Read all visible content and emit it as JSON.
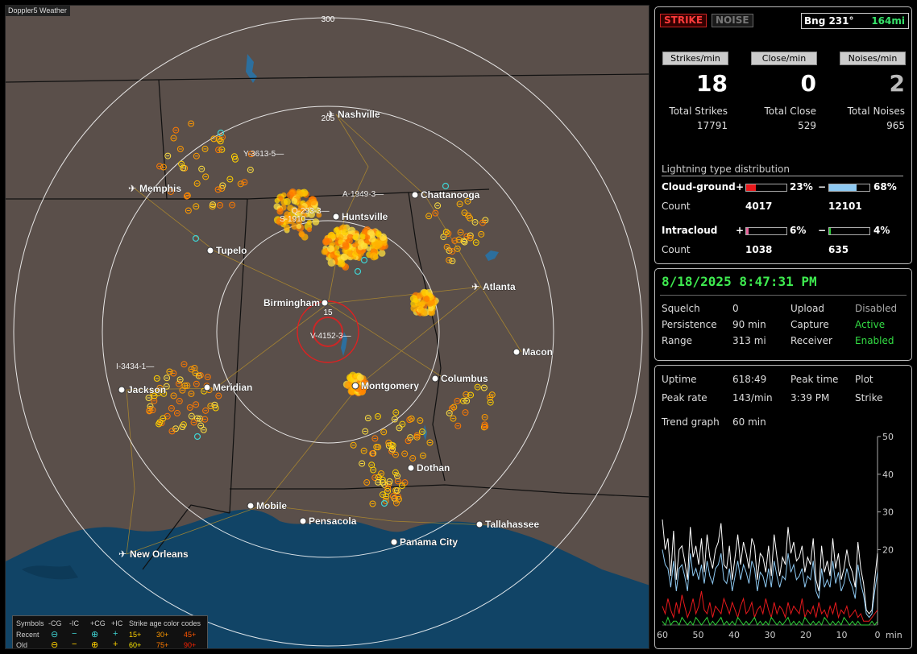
{
  "app": {
    "title": "Doppler5 Weather"
  },
  "map": {
    "rings": [
      {
        "label": "15"
      },
      {
        "label": "205"
      },
      {
        "label": "300"
      }
    ],
    "cities": [
      {
        "name": "Nashville",
        "kind": "airport"
      },
      {
        "name": "Memphis",
        "kind": "airport"
      },
      {
        "name": "Chattanooga",
        "kind": "city"
      },
      {
        "name": "Huntsville",
        "kind": "city"
      },
      {
        "name": "Tupelo",
        "kind": "city"
      },
      {
        "name": "Atlanta",
        "kind": "airport"
      },
      {
        "name": "Birmingham",
        "kind": "city"
      },
      {
        "name": "Macon",
        "kind": "city"
      },
      {
        "name": "Jackson",
        "kind": "city"
      },
      {
        "name": "Meridian",
        "kind": "city"
      },
      {
        "name": "Montgomery",
        "kind": "city"
      },
      {
        "name": "Columbus",
        "kind": "city"
      },
      {
        "name": "Dothan",
        "kind": "city"
      },
      {
        "name": "Mobile",
        "kind": "city"
      },
      {
        "name": "Pensacola",
        "kind": "city"
      },
      {
        "name": "Tallahassee",
        "kind": "city"
      },
      {
        "name": "Panama City",
        "kind": "city"
      },
      {
        "name": "New Orleans",
        "kind": "airport"
      }
    ],
    "cell_labels": [
      "Y-3613-5",
      "A-1949-3",
      "Q-293-3",
      "S-1910",
      "V-4152-3",
      "I-3434-1"
    ],
    "legend": {
      "symbols_label": "Symbols",
      "cols": [
        "-CG",
        "-IC",
        "+CG",
        "+IC"
      ],
      "recent_label": "Recent",
      "old_label": "Old",
      "age_label": "Strike age color codes",
      "recent_ages": [
        "15+",
        "30+",
        "45+"
      ],
      "old_ages": [
        "60+",
        "75+",
        "90+"
      ],
      "age_colors": [
        "#ffd000",
        "#ff9900",
        "#ff5500",
        "#ffea00",
        "#ff7a00",
        "#ff2200"
      ]
    }
  },
  "strike_panel": {
    "strike_tab": "STRIKE",
    "noise_tab": "NOISE",
    "bearing": "Bng 231°",
    "distance": "164mi",
    "strikes_per_min_label": "Strikes/min",
    "close_per_min_label": "Close/min",
    "noises_per_min_label": "Noises/min",
    "strikes_per_min": "18",
    "close_per_min": "0",
    "noises_per_min": "2",
    "total_strikes_label": "Total Strikes",
    "total_close_label": "Total Close",
    "total_noises_label": "Total Noises",
    "total_strikes": "17791",
    "total_close": "529",
    "total_noises": "965",
    "distribution_title": "Lightning type distribution",
    "cloud_ground_label": "Cloud-ground",
    "intracloud_label": "Intracloud",
    "count_label": "Count",
    "plus": "+",
    "minus": "−",
    "cg_pos_pct_text": "23%",
    "cg_neg_pct_text": "68%",
    "cg_pos_count": "4017",
    "cg_neg_count": "12101",
    "ic_pos_pct_text": "6%",
    "ic_neg_pct_text": "4%",
    "ic_pos_count": "1038",
    "ic_neg_count": "635",
    "bar_levels": {
      "cg_pos": 0.23,
      "cg_neg": 0.68,
      "ic_pos": 0.06,
      "ic_neg": 0.04
    },
    "colors": {
      "cg_pos": "#e8191c",
      "cg_neg": "#8ec9f2",
      "ic_pos": "#e8639b",
      "ic_neg": "#2fcf3a"
    }
  },
  "status_panel": {
    "timestamp": "8/18/2025 8:47:31 PM",
    "squelch_label": "Squelch",
    "squelch": "0",
    "persistence_label": "Persistence",
    "persistence": "90 min",
    "range_label": "Range",
    "range": "313 mi",
    "upload_label": "Upload",
    "upload": "Disabled",
    "capture_label": "Capture",
    "capture": "Active",
    "receiver_label": "Receiver",
    "receiver": "Enabled"
  },
  "trend_panel": {
    "uptime_label": "Uptime",
    "uptime": "618:49",
    "peak_time_label": "Peak time",
    "peak_time": "3:39 PM",
    "plot_label": "Plot",
    "plot": "Strike",
    "peak_rate_label": "Peak rate",
    "peak_rate": "143/min",
    "trend_label": "Trend graph",
    "trend": "60 min"
  },
  "chart_data": {
    "type": "line",
    "xlabel": "min",
    "x_ticks": [
      "60",
      "50",
      "40",
      "30",
      "20",
      "10",
      "0"
    ],
    "y_ticks": [
      "20",
      "30",
      "40",
      "50"
    ],
    "xlim": [
      60,
      0
    ],
    "ylim": [
      0,
      50
    ],
    "series": [
      {
        "color": "#ffffff",
        "values": [
          28,
          20,
          23,
          13,
          25,
          12,
          20,
          21,
          17,
          12,
          26,
          18,
          21,
          16,
          23,
          14,
          24,
          18,
          15,
          20,
          22,
          27,
          16,
          15,
          21,
          12,
          18,
          24,
          16,
          22,
          19,
          15,
          23,
          21,
          12,
          19,
          18,
          14,
          21,
          13,
          24,
          18,
          13,
          18,
          16,
          26,
          19,
          22,
          17,
          18,
          21,
          14,
          18,
          16,
          23,
          12,
          9,
          21,
          14,
          17,
          13,
          23,
          15,
          19,
          12,
          15,
          20,
          16,
          14,
          10,
          22,
          15,
          11,
          4,
          3,
          4,
          12,
          19
        ]
      },
      {
        "color": "#8ec9f2",
        "values": [
          20,
          16,
          15,
          10,
          17,
          9,
          15,
          16,
          13,
          9,
          19,
          13,
          15,
          12,
          16,
          11,
          17,
          13,
          11,
          15,
          16,
          19,
          12,
          11,
          15,
          9,
          13,
          17,
          12,
          16,
          14,
          11,
          17,
          15,
          9,
          14,
          13,
          10,
          15,
          10,
          17,
          13,
          10,
          13,
          12,
          19,
          14,
          16,
          12,
          13,
          15,
          10,
          13,
          12,
          17,
          9,
          7,
          15,
          10,
          12,
          10,
          17,
          11,
          14,
          9,
          11,
          15,
          12,
          10,
          7,
          16,
          11,
          8,
          3,
          2,
          3,
          9,
          14
        ]
      },
      {
        "color": "#e8191c",
        "values": [
          5,
          3,
          7,
          4,
          2,
          6,
          3,
          8,
          5,
          2,
          4,
          7,
          3,
          5,
          9,
          4,
          3,
          6,
          2,
          5,
          4,
          3,
          7,
          5,
          3,
          6,
          4,
          2,
          5,
          7,
          3,
          4,
          6,
          2,
          4,
          5,
          3,
          7,
          4,
          2,
          6,
          3,
          5,
          4,
          2,
          6,
          3,
          5,
          4,
          3,
          7,
          2,
          4,
          3,
          5,
          2,
          6,
          3,
          4,
          2,
          5,
          3,
          6,
          2,
          4,
          3,
          5,
          2,
          3,
          4,
          2,
          3,
          1,
          1,
          1,
          2,
          3,
          4
        ]
      },
      {
        "color": "#2fcf3a",
        "values": [
          1,
          0,
          2,
          0,
          1,
          1,
          0,
          2,
          1,
          0,
          1,
          0,
          2,
          1,
          0,
          1,
          2,
          0,
          1,
          0,
          1,
          2,
          0,
          1,
          0,
          1,
          0,
          2,
          1,
          0,
          1,
          0,
          1,
          2,
          0,
          1,
          0,
          1,
          0,
          2,
          1,
          0,
          1,
          0,
          1,
          2,
          0,
          1,
          0,
          1,
          0,
          2,
          1,
          0,
          1,
          0,
          1,
          0,
          2,
          1,
          0,
          1,
          0,
          1,
          0,
          2,
          1,
          0,
          1,
          0,
          1,
          0,
          0,
          0,
          0,
          1,
          0,
          1
        ]
      }
    ]
  }
}
